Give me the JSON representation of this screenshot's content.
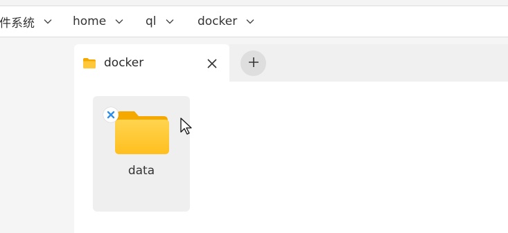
{
  "breadcrumb": {
    "items": [
      {
        "label": "件系统"
      },
      {
        "label": "home"
      },
      {
        "label": "ql"
      },
      {
        "label": "docker"
      }
    ],
    "separator_icon": "chevron-down-icon"
  },
  "tabs": {
    "active": {
      "label": "docker",
      "icon": "folder-icon",
      "close_icon": "close-icon"
    },
    "new_tab_icon": "plus-icon"
  },
  "files": [
    {
      "name": "data",
      "icon": "folder-icon",
      "badge_icon": "x-badge-icon"
    }
  ],
  "colors": {
    "folder": "#ffc83a",
    "folder_dark": "#f5a800",
    "badge_x": "#2f8ee8",
    "tab_bg": "#ffffff",
    "tabbar_bg": "#f0f0f0",
    "sidebar_bg": "#f5f5f5"
  }
}
